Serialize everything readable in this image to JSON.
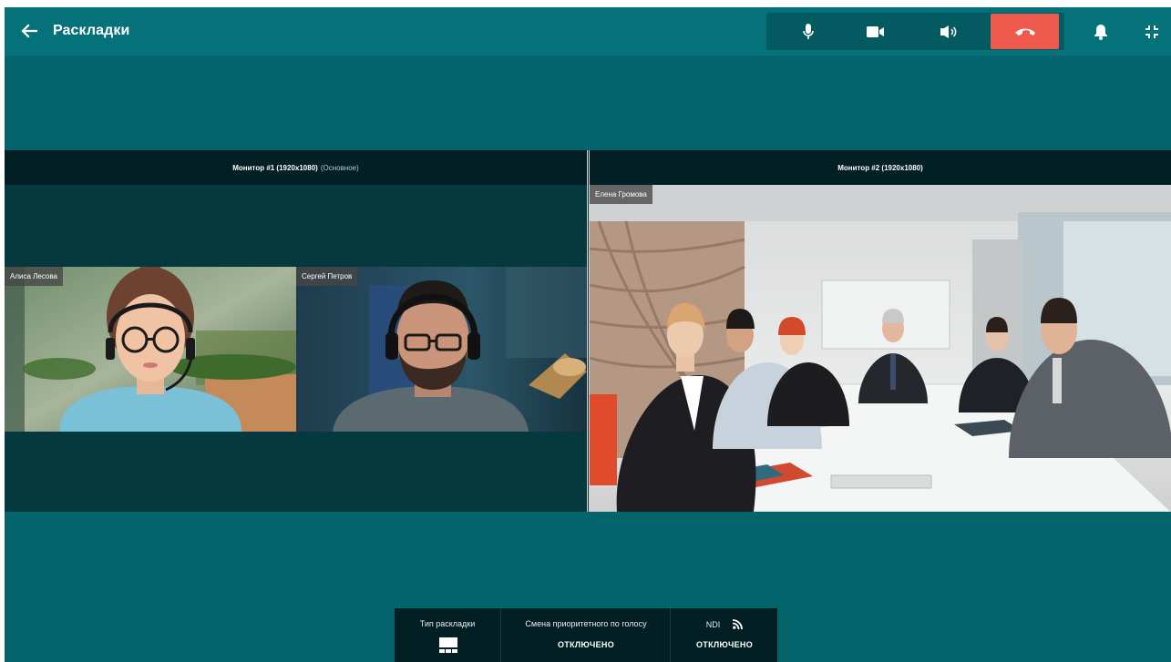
{
  "header": {
    "title": "Раскладки",
    "icons": {
      "back": "arrow-left-icon",
      "mic": "microphone-icon",
      "camera": "video-camera-icon",
      "speaker": "speaker-icon",
      "hangup": "hang-up-icon",
      "bell": "bell-icon",
      "collapse": "exit-fullscreen-icon"
    },
    "colors": {
      "bar": "#05727a",
      "controls_bg": "#035a61",
      "hangup": "#ee5a4d"
    }
  },
  "monitors": [
    {
      "title": "Монитор #1 (1920x1080)",
      "subtitle": "(Основное)",
      "participants": [
        "Алиса Лесова",
        "Сергей Петров"
      ]
    },
    {
      "title": "Монитор #2 (1920x1080)",
      "subtitle": "",
      "participants": [
        "Елена Громова"
      ]
    }
  ],
  "bottom_panel": {
    "layout_type": {
      "label": "Тип раскладки",
      "icon": "layout-grid-icon"
    },
    "voice_priority": {
      "label": "Смена приоритетного по голосу",
      "value": "ОТКЛЮЧЕНО"
    },
    "ndi": {
      "label": "NDI",
      "value": "ОТКЛЮЧЕНО",
      "icon": "rss-icon"
    }
  },
  "colors": {
    "background": "#04646b",
    "monitor_header": "#021f23",
    "monitor_body": "#06393f"
  }
}
